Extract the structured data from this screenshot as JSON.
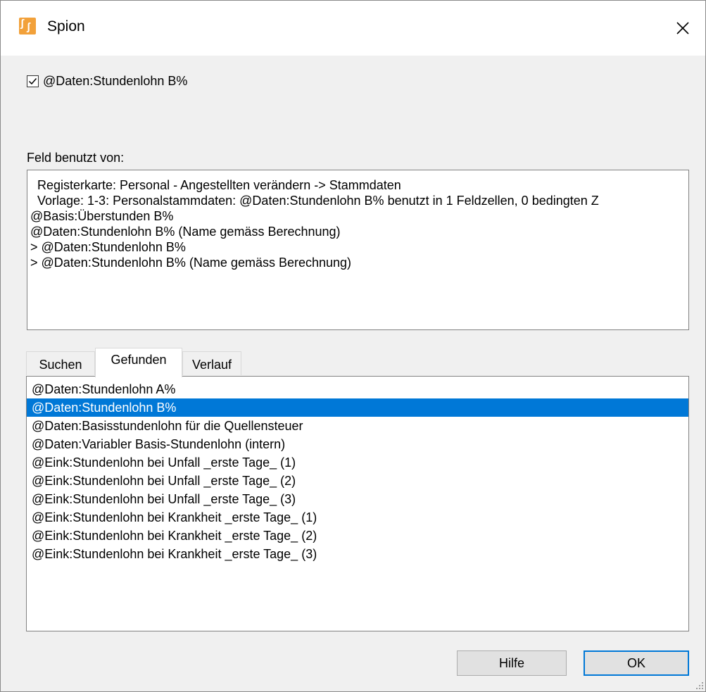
{
  "window": {
    "title": "Spion",
    "icon": "spion-app-icon",
    "close_icon": "close-icon"
  },
  "field": {
    "checked": true,
    "label": "@Daten:Stundenlohn B%"
  },
  "usage": {
    "label": "Feld benutzt von:",
    "lines": [
      "Registerkarte: Personal - Angestellten verändern -> Stammdaten",
      "Vorlage: 1-3: Personalstammdaten: @Daten:Stundenlohn B% benutzt in 1 Feldzellen, 0 bedingten Z",
      "@Basis:Überstunden B%",
      "@Daten:Stundenlohn B% (Name gemäss Berechnung)",
      "> @Daten:Stundenlohn B%",
      "> @Daten:Stundenlohn B% (Name gemäss Berechnung)"
    ]
  },
  "tabs": [
    {
      "label": "Suchen",
      "active": false
    },
    {
      "label": "Gefunden",
      "active": true
    },
    {
      "label": "Verlauf",
      "active": false
    }
  ],
  "found": {
    "items": [
      "@Daten:Stundenlohn A%",
      "@Daten:Stundenlohn B%",
      "@Daten:Basisstundenlohn für die Quellensteuer",
      "@Daten:Variabler Basis-Stundenlohn (intern)",
      "@Eink:Stundenlohn bei Unfall  _erste Tage_ (1)",
      "@Eink:Stundenlohn bei Unfall  _erste Tage_ (2)",
      "@Eink:Stundenlohn bei Unfall  _erste Tage_ (3)",
      "@Eink:Stundenlohn bei Krankheit _erste Tage_ (1)",
      "@Eink:Stundenlohn bei Krankheit _erste Tage_ (2)",
      "@Eink:Stundenlohn bei Krankheit _erste Tage_ (3)"
    ],
    "selected_index": 1
  },
  "buttons": {
    "help_label": "Hilfe",
    "ok_label": "OK"
  },
  "colors": {
    "selection": "#0078d7",
    "accent": "#0078d7",
    "icon_orange": "#f2a13a"
  }
}
